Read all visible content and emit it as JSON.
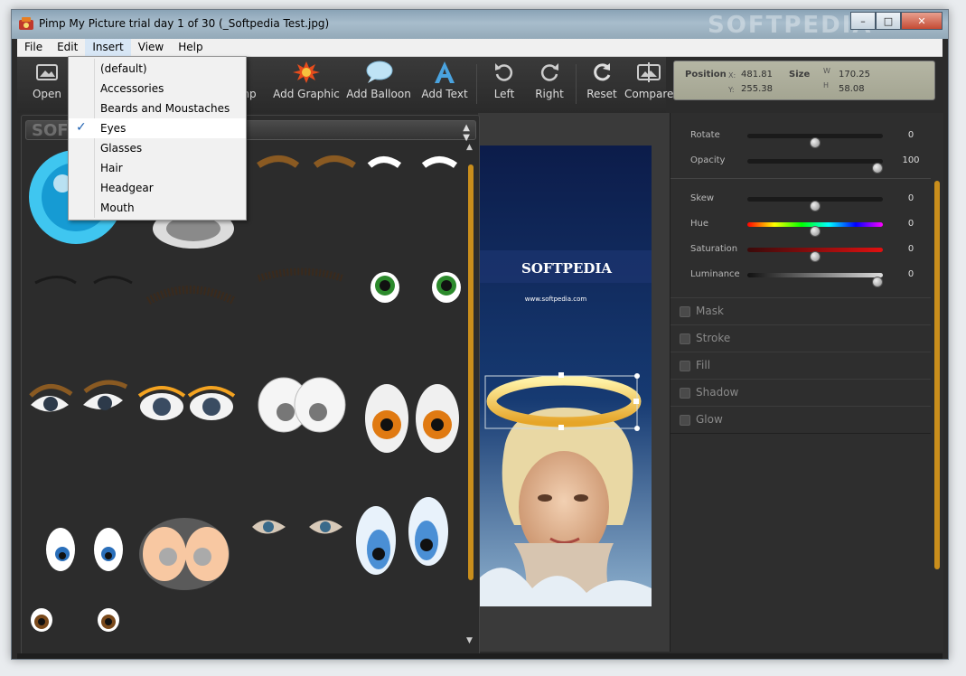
{
  "window": {
    "title": "Pimp My Picture trial day 1 of 30 (_Softpedia Test.jpg)",
    "watermark": "SOFTPEDIA",
    "minimize": "–",
    "maximize": "□",
    "close": "✕"
  },
  "menu": [
    "File",
    "Edit",
    "Insert",
    "View",
    "Help"
  ],
  "insert_menu": {
    "items": [
      "(default)",
      "Accessories",
      "Beards and Moustaches",
      "Eyes",
      "Glasses",
      "Hair",
      "Headgear",
      "Mouth"
    ],
    "checked": "Eyes",
    "check_mark": "✓"
  },
  "toolbar": {
    "open": "Open",
    "stamp_partial": "mp",
    "add_graphic": "Add Graphic",
    "add_balloon": "Add Balloon",
    "add_text": "Add Text",
    "left": "Left",
    "right": "Right",
    "reset": "Reset",
    "compare": "Compare"
  },
  "info": {
    "position_label": "Position",
    "x_label": "X:",
    "x_value": "481.81",
    "y_label": "Y:",
    "y_value": "255.38",
    "size_label": "Size",
    "w_label": "W",
    "w_value": "170.25",
    "h_label": "H",
    "h_value": "58.08"
  },
  "adjust": {
    "rotate": {
      "label": "Rotate",
      "value": "0",
      "level": 0.5
    },
    "opacity": {
      "label": "Opacity",
      "value": "100",
      "level": 1.0
    },
    "skew": {
      "label": "Skew",
      "value": "0",
      "level": 0.5
    },
    "hue": {
      "label": "Hue",
      "value": "0",
      "level": 0.5
    },
    "saturation": {
      "label": "Saturation",
      "value": "0",
      "level": 0.5
    },
    "luminance": {
      "label": "Luminance",
      "value": "0",
      "level": 1.0
    }
  },
  "sections": [
    "Mask",
    "Stroke",
    "Fill",
    "Shadow",
    "Glow"
  ],
  "category_select": {
    "watermark": "SOFTPEDIA",
    "url": "www.softpedia.com"
  },
  "photo": {
    "brand": "SOFTPEDIA",
    "url": "www.softpedia.com"
  },
  "colors": {
    "accent": "#c98e1c",
    "panel": "#2c2c2c",
    "halo": "#f1c24c"
  }
}
